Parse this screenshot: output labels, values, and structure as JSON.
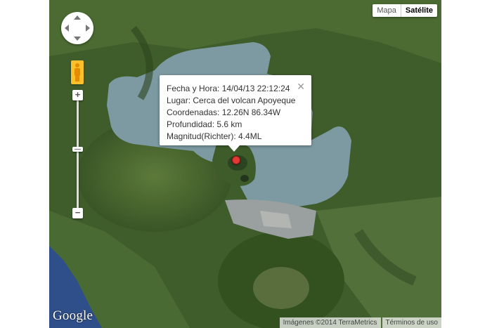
{
  "map_type": {
    "options": [
      "Mapa",
      "Satélite"
    ],
    "selected": "Satélite"
  },
  "controls": {
    "zoom_in": "+",
    "zoom_out": "−",
    "zoom_level_fraction": 0.45
  },
  "info_window": {
    "lines": [
      "Fecha y Hora: 14/04/13 22:12:24",
      "Lugar: Cerca del volcan Apoyeque",
      "Coordenadas: 12.26N 86.34W",
      "Profundidad: 5.6 km",
      "Magnitud(Richter): 4.4ML"
    ],
    "close_glyph": "✕"
  },
  "marker": {
    "color": "#e53935"
  },
  "footer": {
    "logo": "Google",
    "imagery": "Imágenes ©2014 TerraMetrics",
    "terms": "Términos de uso"
  },
  "colors": {
    "lake": "#7d9aa3",
    "forest": "#3c5b28",
    "ocean": "#2f4f8a",
    "urban": "#9aa0a0"
  }
}
